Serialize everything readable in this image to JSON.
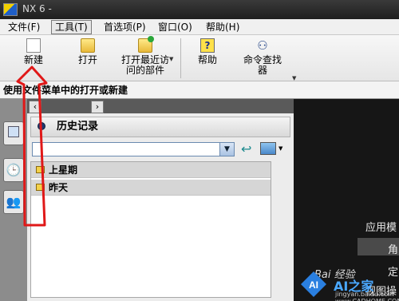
{
  "window": {
    "title": "NX 6 -"
  },
  "menu": {
    "items": [
      "文件(F)",
      "工具(T)",
      "首选项(P)",
      "窗口(O)",
      "帮助(H)"
    ],
    "active": "工具(T)"
  },
  "toolbar": {
    "new": {
      "label": "新建",
      "icon": "new-document-icon"
    },
    "open": {
      "label": "打开",
      "icon": "open-folder-icon"
    },
    "recent": {
      "label_line1": "打开最近访",
      "label_line2": "问的部件",
      "icon": "recent-folder-icon"
    },
    "help": {
      "label": "帮助",
      "icon": "help-icon"
    },
    "command_finder": {
      "label_line1": "命令查找",
      "label_line2": "器",
      "icon": "binoculars-icon"
    }
  },
  "status": {
    "text": "使用文件菜单中的打开或新建"
  },
  "history_panel": {
    "title": "历史记录",
    "groups": [
      "上星期",
      "昨天"
    ]
  },
  "side_tabs": [
    "clock-icon",
    "roles-icon"
  ],
  "right_panel": {
    "lines": [
      "应用模",
      "角",
      "定",
      "视图操"
    ]
  },
  "watermark": {
    "baidu": "Bai 经验",
    "site": "AI之家",
    "url": "jingyan.baidu.com  www.CADHOME.COM"
  },
  "colors": {
    "annotation_arrow": "#e01818",
    "accent": "#1f5fc8"
  }
}
